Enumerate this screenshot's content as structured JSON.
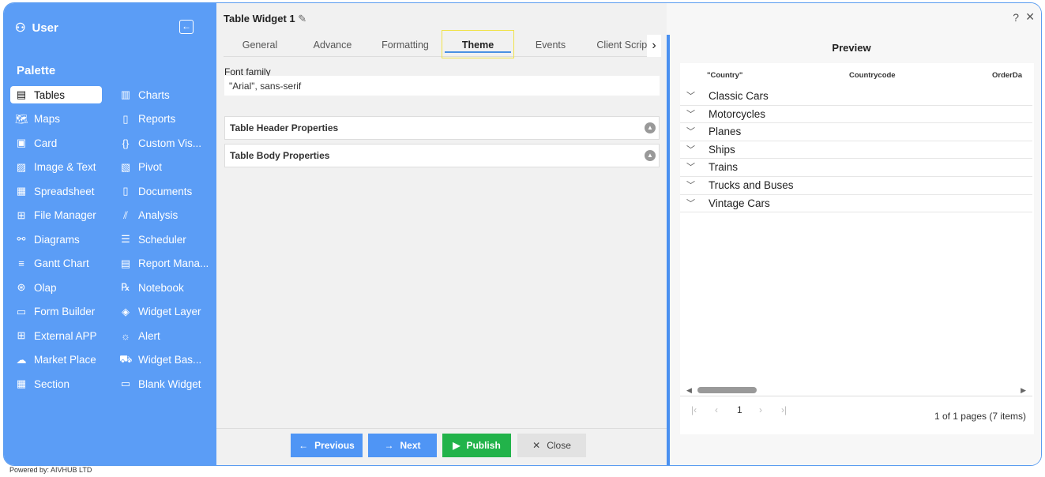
{
  "sidebar": {
    "user": "User",
    "palette": "Palette",
    "col1": [
      {
        "label": "Tables",
        "icon": "table-icon",
        "g": "▤"
      },
      {
        "label": "Maps",
        "icon": "map-icon",
        "g": "🗺"
      },
      {
        "label": "Card",
        "icon": "card-icon",
        "g": "▣"
      },
      {
        "label": "Image & Text",
        "icon": "image-icon",
        "g": "▨"
      },
      {
        "label": "Spreadsheet",
        "icon": "spreadsheet-icon",
        "g": "▦"
      },
      {
        "label": "File Manager",
        "icon": "file-manager-icon",
        "g": "⊞"
      },
      {
        "label": "Diagrams",
        "icon": "diagram-icon",
        "g": "⚯"
      },
      {
        "label": "Gantt Chart",
        "icon": "gantt-icon",
        "g": "≡"
      },
      {
        "label": "Olap",
        "icon": "olap-icon",
        "g": "⊛"
      },
      {
        "label": "Form Builder",
        "icon": "form-icon",
        "g": "▭"
      },
      {
        "label": "External APP",
        "icon": "external-app-icon",
        "g": "⊞"
      },
      {
        "label": "Market Place",
        "icon": "cloud-icon",
        "g": "☁"
      },
      {
        "label": "Section",
        "icon": "section-icon",
        "g": "▦"
      }
    ],
    "col2": [
      {
        "label": "Charts",
        "icon": "chart-icon",
        "g": "▥"
      },
      {
        "label": "Reports",
        "icon": "report-icon",
        "g": "▯"
      },
      {
        "label": "Custom Vis...",
        "icon": "braces-icon",
        "g": "{}"
      },
      {
        "label": "Pivot",
        "icon": "pivot-icon",
        "g": "▧"
      },
      {
        "label": "Documents",
        "icon": "document-icon",
        "g": "▯"
      },
      {
        "label": "Analysis",
        "icon": "analysis-icon",
        "g": "⫽"
      },
      {
        "label": "Scheduler",
        "icon": "scheduler-icon",
        "g": "☰"
      },
      {
        "label": "Report Mana...",
        "icon": "report-manager-icon",
        "g": "▤"
      },
      {
        "label": "Notebook",
        "icon": "notebook-icon",
        "g": "℞"
      },
      {
        "label": "Widget Layer",
        "icon": "layers-icon",
        "g": "◈"
      },
      {
        "label": "Alert",
        "icon": "alert-icon",
        "g": "☼"
      },
      {
        "label": "Widget Bas...",
        "icon": "basket-icon",
        "g": "⛟"
      },
      {
        "label": "Blank Widget",
        "icon": "blank-widget-icon",
        "g": "▭"
      }
    ]
  },
  "editor": {
    "title": "Table Widget 1",
    "tabs": [
      "General",
      "Advance",
      "Formatting",
      "Theme",
      "Events",
      "Client Script"
    ],
    "active_tab": "Theme",
    "font_label": "Font family",
    "font_value": "\"Arial\", sans-serif",
    "sections": [
      "Table Header Properties",
      "Table Body Properties"
    ],
    "buttons": {
      "previous": "Previous",
      "next": "Next",
      "publish": "Publish",
      "close": "Close"
    }
  },
  "preview": {
    "title": "Preview",
    "columns": [
      "\"Country\"",
      "Countrycode",
      "OrderDa"
    ],
    "rows": [
      "Classic Cars",
      "Motorcycles",
      "Planes",
      "Ships",
      "Trains",
      "Trucks and Buses",
      "Vintage Cars"
    ],
    "page": "1",
    "page_info": "1 of 1 pages (7 items)"
  },
  "footer": "Powered by: AIVHUB LTD",
  "colors": {
    "sidebar": "#5b9df6",
    "publish": "#22b34a",
    "primary": "#4f95f5"
  }
}
